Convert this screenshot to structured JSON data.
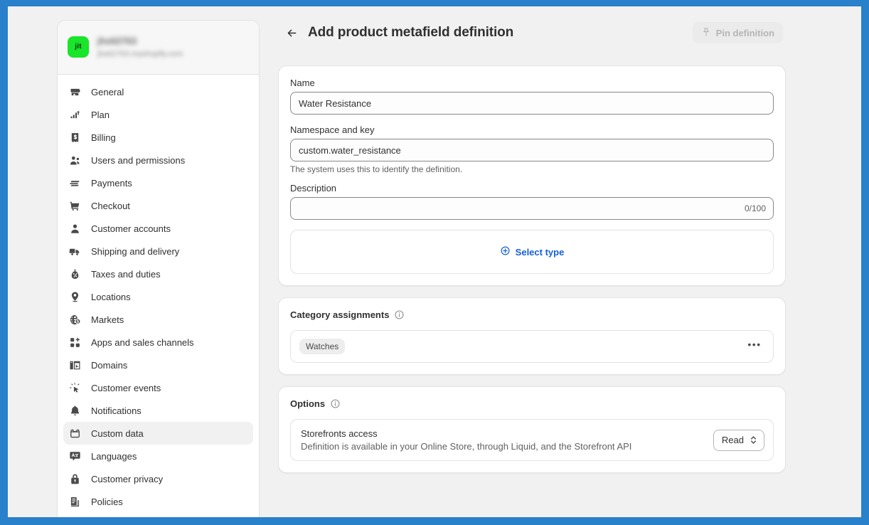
{
  "theme": {
    "frame_color": "#2980cb",
    "page_bg": "#f1f1f1",
    "accent_blue": "#1560d8",
    "avatar_green": "#19e52a",
    "text_primary": "#303030",
    "text_secondary": "#616161"
  },
  "sidebar": {
    "store_name": "jhs62763",
    "store_url": "jhs62763.myshopify.com",
    "avatar_initials": "jit",
    "items": [
      {
        "label": "General",
        "icon": "storefront-icon",
        "active": false
      },
      {
        "label": "Plan",
        "icon": "chart-growth-icon",
        "active": false
      },
      {
        "label": "Billing",
        "icon": "receipt-dollar-icon",
        "active": false
      },
      {
        "label": "Users and permissions",
        "icon": "users-icon",
        "active": false
      },
      {
        "label": "Payments",
        "icon": "payment-card-icon",
        "active": false
      },
      {
        "label": "Checkout",
        "icon": "cart-icon",
        "active": false
      },
      {
        "label": "Customer accounts",
        "icon": "person-icon",
        "active": false
      },
      {
        "label": "Shipping and delivery",
        "icon": "delivery-truck-icon",
        "active": false
      },
      {
        "label": "Taxes and duties",
        "icon": "money-bag-percent-icon",
        "active": false
      },
      {
        "label": "Locations",
        "icon": "location-pin-icon",
        "active": false
      },
      {
        "label": "Markets",
        "icon": "globe-dollar-icon",
        "active": false
      },
      {
        "label": "Apps and sales channels",
        "icon": "apps-grid-plus-icon",
        "active": false
      },
      {
        "label": "Domains",
        "icon": "domain-window-icon",
        "active": false
      },
      {
        "label": "Customer events",
        "icon": "cursor-click-icon",
        "active": false
      },
      {
        "label": "Notifications",
        "icon": "bell-icon",
        "active": false
      },
      {
        "label": "Custom data",
        "icon": "metafields-box-icon",
        "active": true
      },
      {
        "label": "Languages",
        "icon": "language-translate-icon",
        "active": false
      },
      {
        "label": "Customer privacy",
        "icon": "lock-icon",
        "active": false
      },
      {
        "label": "Policies",
        "icon": "policy-document-icon",
        "active": false
      }
    ]
  },
  "header": {
    "back_label": "back-arrow",
    "title": "Add product metafield definition",
    "pin_button": "Pin definition",
    "pin_button_disabled": true
  },
  "form": {
    "name": {
      "label": "Name",
      "value": "Water Resistance",
      "placeholder": ""
    },
    "namespace_key": {
      "label": "Namespace and key",
      "value": "custom.water_resistance",
      "placeholder": "",
      "help": "The system uses this to identify the definition."
    },
    "description": {
      "label": "Description",
      "value": "",
      "placeholder": "",
      "counter": "0/100"
    },
    "select_type": {
      "label": "Select type",
      "icon": "circle-plus-icon"
    }
  },
  "category_assignments": {
    "title": "Category assignments",
    "info_icon": "info-circle-icon",
    "tags": [
      "Watches"
    ],
    "more_label": "•••"
  },
  "options": {
    "title": "Options",
    "info_icon": "info-circle-icon",
    "rows": [
      {
        "title": "Storefronts access",
        "description": "Definition is available in your Online Store, through Liquid, and the Storefront API",
        "select_value": "Read"
      }
    ]
  }
}
